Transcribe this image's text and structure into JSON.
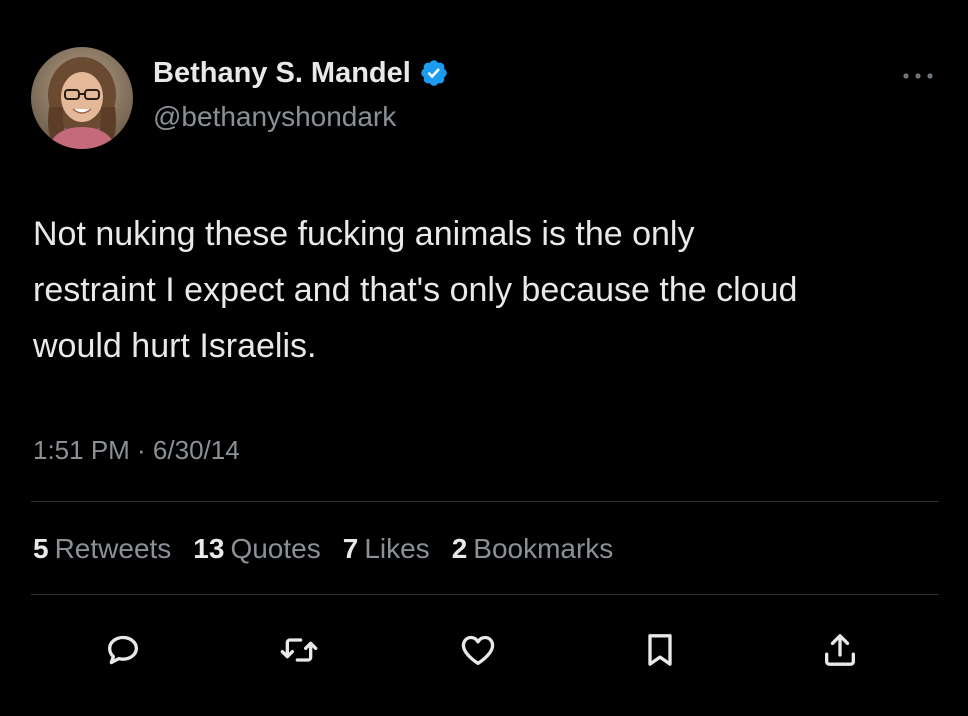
{
  "author": {
    "display_name": "Bethany S. Mandel",
    "handle": "@bethanyshondark",
    "verified_badge": "verified-check-icon",
    "avatar_icon": "avatar-photo"
  },
  "tweet": {
    "text_lines": [
      "Not nuking these fucking animals is the only",
      "restraint I expect and that's only because the cloud",
      "would hurt Israelis."
    ],
    "timestamp": "1:51 PM · 6/30/14"
  },
  "stats": [
    {
      "count": "5",
      "label": "Retweets"
    },
    {
      "count": "13",
      "label": "Quotes"
    },
    {
      "count": "7",
      "label": "Likes"
    },
    {
      "count": "2",
      "label": "Bookmarks"
    }
  ],
  "actions": [
    {
      "icon": "reply-icon"
    },
    {
      "icon": "retweet-icon"
    },
    {
      "icon": "like-icon"
    },
    {
      "icon": "bookmark-icon"
    },
    {
      "icon": "share-icon"
    }
  ],
  "colors": {
    "background": "#000000",
    "text_primary": "#e7e9ea",
    "text_secondary": "#8b9096",
    "verified_blue": "#1d9bf0",
    "divider": "#2b2f33"
  }
}
